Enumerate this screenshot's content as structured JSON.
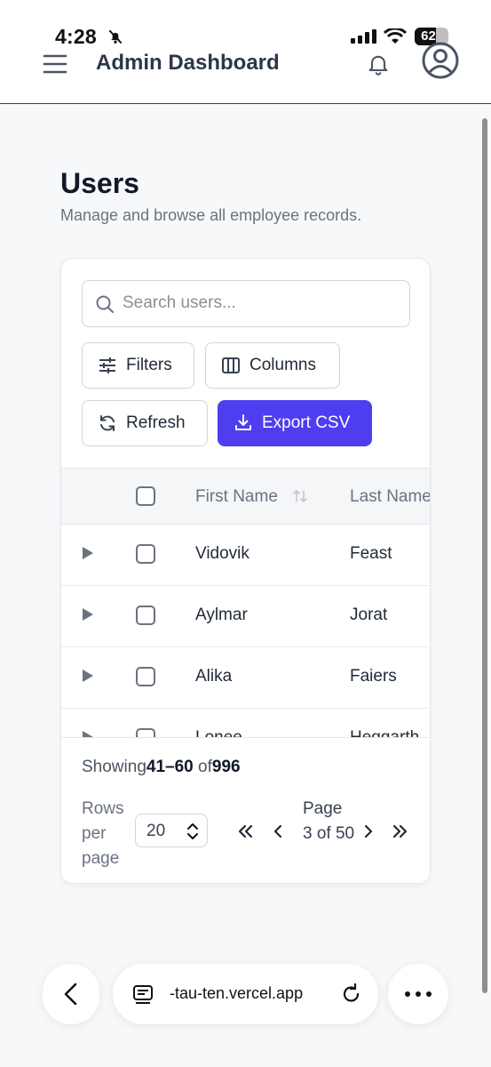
{
  "status_bar": {
    "time": "4:28",
    "battery_percent": "62",
    "battery_level": 0.62
  },
  "header": {
    "title": "Admin Dashboard",
    "icons": [
      "menu-icon",
      "bell-icon",
      "user-avatar-icon"
    ]
  },
  "page": {
    "title": "Users",
    "subtitle": "Manage and browse all employee records."
  },
  "toolbar": {
    "search_placeholder": "Search users...",
    "search_value": "",
    "filters_label": "Filters",
    "columns_label": "Columns",
    "refresh_label": "Refresh",
    "export_label": "Export CSV"
  },
  "table": {
    "columns": [
      "First Name",
      "Last Name"
    ],
    "rows": [
      {
        "first_name": "Vidovik",
        "last_name": "Feast"
      },
      {
        "first_name": "Aylmar",
        "last_name": "Jorat"
      },
      {
        "first_name": "Alika",
        "last_name": "Faiers"
      },
      {
        "first_name": "Lonee",
        "last_name": "Heggarth"
      }
    ]
  },
  "pagination": {
    "showing_prefix": "Showing",
    "range": "41–60",
    "of_text": "of",
    "total": "996",
    "rows_per_page_label": "Rows per page",
    "rows_per_page_value": "20",
    "page_label": "Page 3 of 50"
  },
  "browser": {
    "url": "-tau-ten.vercel.app"
  },
  "colors": {
    "accent": "#4f3df0",
    "text_primary": "#111827",
    "text_muted": "#6b7280",
    "border": "#d1d5db"
  }
}
